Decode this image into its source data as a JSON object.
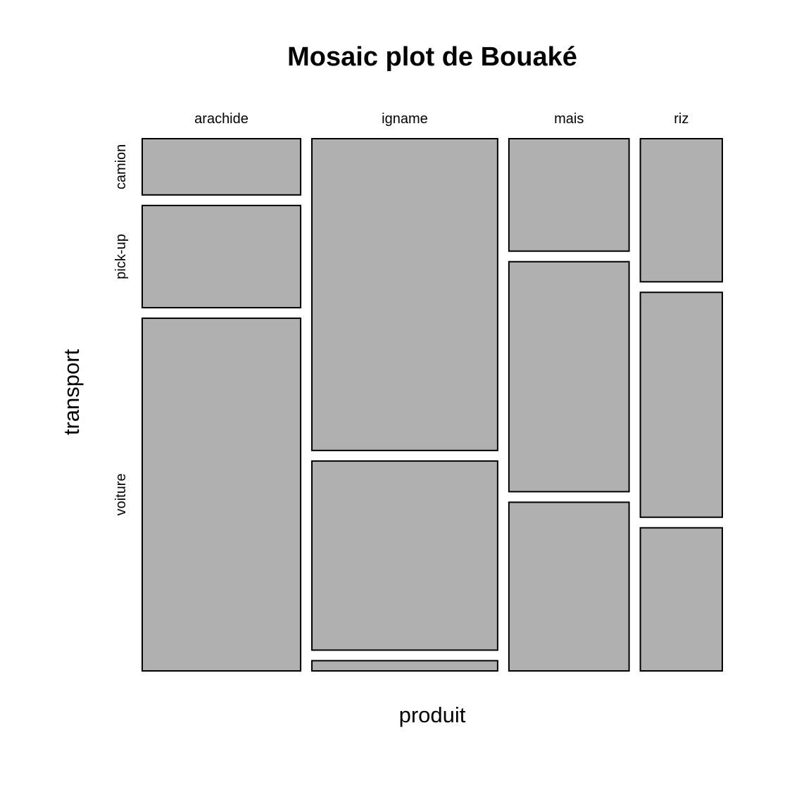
{
  "chart_data": {
    "type": "mosaic",
    "title": "Mosaic plot de Bouaké",
    "xlabel": "produit",
    "ylabel": "transport",
    "x_categories": [
      "arachide",
      "igname",
      "mais",
      "riz"
    ],
    "y_categories": [
      "camion",
      "pick-up",
      "voiture"
    ],
    "x_proportions": [
      0.29,
      0.34,
      0.22,
      0.15
    ],
    "conditional_proportions": [
      [
        0.11,
        0.2,
        0.69
      ],
      [
        0.61,
        0.37,
        0.02
      ],
      [
        0.22,
        0.45,
        0.33
      ],
      [
        0.28,
        0.44,
        0.28
      ]
    ],
    "fill_color": "#b0b0b0",
    "border_color": "#000000",
    "grid": false,
    "legend": "none"
  }
}
